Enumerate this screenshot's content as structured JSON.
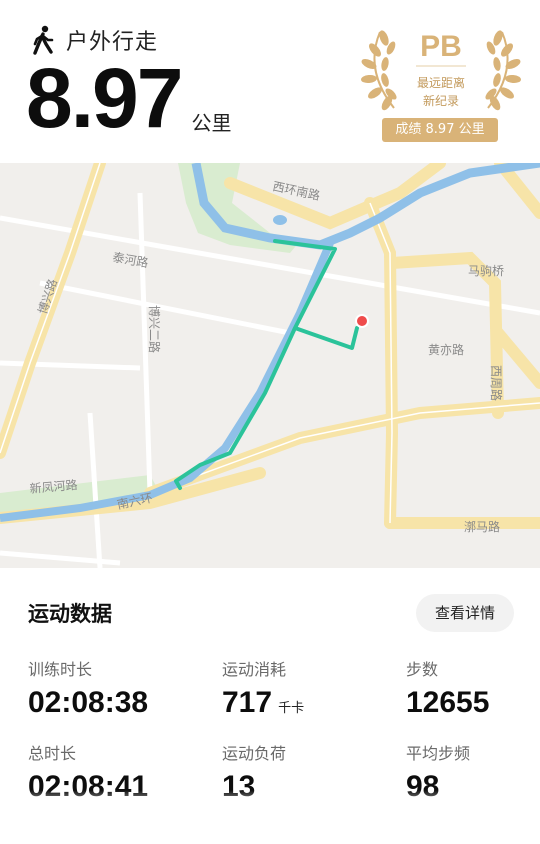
{
  "activity": {
    "label": "户外行走",
    "icon": "walking-person-icon"
  },
  "distance": {
    "value": "8.97",
    "unit": "公里"
  },
  "badge": {
    "title": "PB",
    "line1": "最远距离",
    "line2": "新纪录",
    "result": "成绩 8.97 公里",
    "color": "#d9b378"
  },
  "map": {
    "roads": [
      "西环南路",
      "泰河路",
      "博兴路",
      "博兴二路",
      "马驹桥",
      "黄亦路",
      "西周路",
      "新凤河路",
      "南六环",
      "漷马路"
    ],
    "route_color": "#2bc39a",
    "end_marker_color": "#ef4b4b"
  },
  "stats": {
    "title": "运动数据",
    "details_button": "查看详情",
    "items": [
      {
        "label": "训练时长",
        "value": "02:08:38",
        "unit": ""
      },
      {
        "label": "运动消耗",
        "value": "717",
        "unit": "千卡"
      },
      {
        "label": "步数",
        "value": "12655",
        "unit": ""
      },
      {
        "label": "总时长",
        "value": "02:08:41",
        "unit": ""
      },
      {
        "label": "运动负荷",
        "value": "13",
        "unit": ""
      },
      {
        "label": "平均步频",
        "value": "98",
        "unit": ""
      }
    ]
  }
}
